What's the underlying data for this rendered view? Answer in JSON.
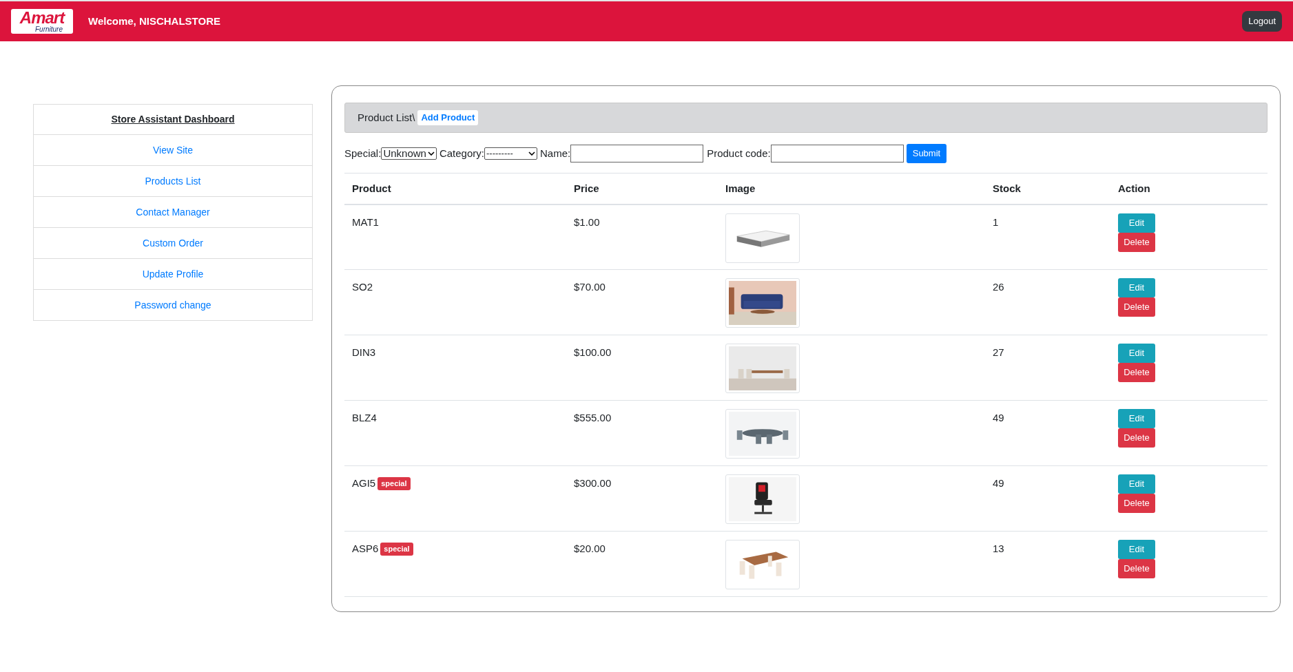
{
  "header": {
    "logo": {
      "word": "Amart",
      "sub": "Furniture"
    },
    "welcome": "Welcome, NISCHALSTORE",
    "logout": "Logout"
  },
  "sidebar": {
    "title": "Store Assistant Dashboard",
    "items": [
      {
        "label": "View Site"
      },
      {
        "label": "Products List"
      },
      {
        "label": "Contact Manager"
      },
      {
        "label": "Custom Order"
      },
      {
        "label": "Update Profile"
      },
      {
        "label": "Password change"
      }
    ]
  },
  "breadcrumb": {
    "current": "Product List\\",
    "link": "Add Product"
  },
  "filters": {
    "special_label": "Special:",
    "special_value": "Unknown",
    "category_label": "Category:",
    "category_value": "---------",
    "name_label": "Name:",
    "code_label": "Product code:",
    "submit": "Submit"
  },
  "table": {
    "columns": [
      "Product",
      "Price",
      "Image",
      "Stock",
      "Action"
    ],
    "rows": [
      {
        "product": "MAT1",
        "price": "$1.00",
        "stock": "1",
        "edit": "Edit",
        "delete": "Delete"
      },
      {
        "product": "SO2",
        "price": "$70.00",
        "stock": "26",
        "edit": "Edit",
        "delete": "Delete"
      },
      {
        "product": "DIN3",
        "price": "$100.00",
        "stock": "27",
        "edit": "Edit",
        "delete": "Delete"
      },
      {
        "product": "BLZ4",
        "price": "$555.00",
        "stock": "49",
        "edit": "Edit",
        "delete": "Delete"
      },
      {
        "product": "AGI5",
        "badge": "special",
        "price": "$300.00",
        "stock": "49",
        "edit": "Edit",
        "delete": "Delete"
      },
      {
        "product": "ASP6",
        "badge": "special",
        "price": "$20.00",
        "stock": "13",
        "edit": "Edit",
        "delete": "Delete"
      }
    ]
  }
}
